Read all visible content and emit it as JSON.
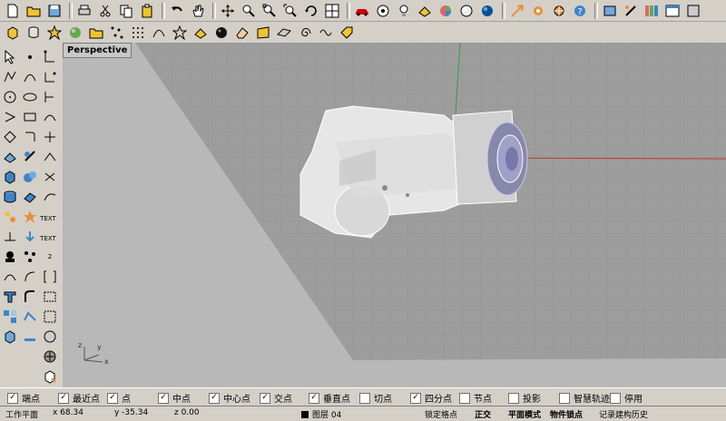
{
  "toolbar_main": {
    "icons": [
      "new-file-icon",
      "open-folder-icon",
      "save-icon",
      "print-icon",
      "cut-icon",
      "copy-icon",
      "paste-icon",
      "undo-icon",
      "pan-hand-icon",
      "move-icon",
      "zoom-icon",
      "zoom-window-icon",
      "zoom-extents-icon",
      "rotate-view-icon",
      "four-viewports-icon",
      "car-icon",
      "target-icon",
      "lightbulb-icon",
      "shade-icon",
      "color-wheel-icon",
      "render-sphere-icon",
      "blue-sphere-icon",
      "arrow-icon",
      "gear-icon",
      "options-icon",
      "help-icon",
      "layer-icon",
      "tools-icon",
      "rgb-icon",
      "window-icon",
      "extra-icon"
    ]
  },
  "toolbar_secondary": {
    "icons": [
      "cube-icon",
      "cylinder-icon",
      "star-icon",
      "sphere-icon",
      "folder-icon",
      "scatter-icon",
      "point-grid-icon",
      "curve-icon",
      "star2-icon",
      "shade-icon",
      "black-sphere-icon",
      "eraser-icon",
      "panel-icon",
      "plane-icon",
      "spiral-icon",
      "twist-icon",
      "tag-icon"
    ]
  },
  "viewport": {
    "title": "Perspective",
    "axis_labels": {
      "z": "z",
      "y": "y",
      "x": "x"
    }
  },
  "osnaps": [
    {
      "label": "端点",
      "checked": "✓"
    },
    {
      "label": "最近点",
      "checked": "✓"
    },
    {
      "label": "点",
      "checked": "✓"
    },
    {
      "label": "中点",
      "checked": "✓"
    },
    {
      "label": "中心点",
      "checked": "✓"
    },
    {
      "label": "交点",
      "checked": "✓"
    },
    {
      "label": "垂直点",
      "checked": "✓"
    },
    {
      "label": "切点",
      "checked": ""
    },
    {
      "label": "四分点",
      "checked": "✓"
    },
    {
      "label": "节点",
      "checked": ""
    },
    {
      "label": "投影",
      "checked": ""
    },
    {
      "label": "智慧轨迹",
      "checked": ""
    },
    {
      "label": "停用",
      "checked": ""
    }
  ],
  "status": {
    "cplane": "工作平面",
    "x": "x 68.34",
    "y": "y -35.34",
    "z": "z 0.00",
    "layer": "图层 04",
    "grid_snap": "锁定格点",
    "ortho": "正交",
    "planar": "平面模式",
    "osnap": "物件锁点",
    "record_history": "记录建构历史"
  },
  "left_toolbar": {
    "text_label_1": "TEXT",
    "text_label_2": "TEXT",
    "num_label": "2"
  },
  "colors": {
    "x_axis": "#c0392b",
    "y_axis": "#2ea043",
    "viewport_bg": "#9d9d9d",
    "plane": "#b8b8b8"
  }
}
